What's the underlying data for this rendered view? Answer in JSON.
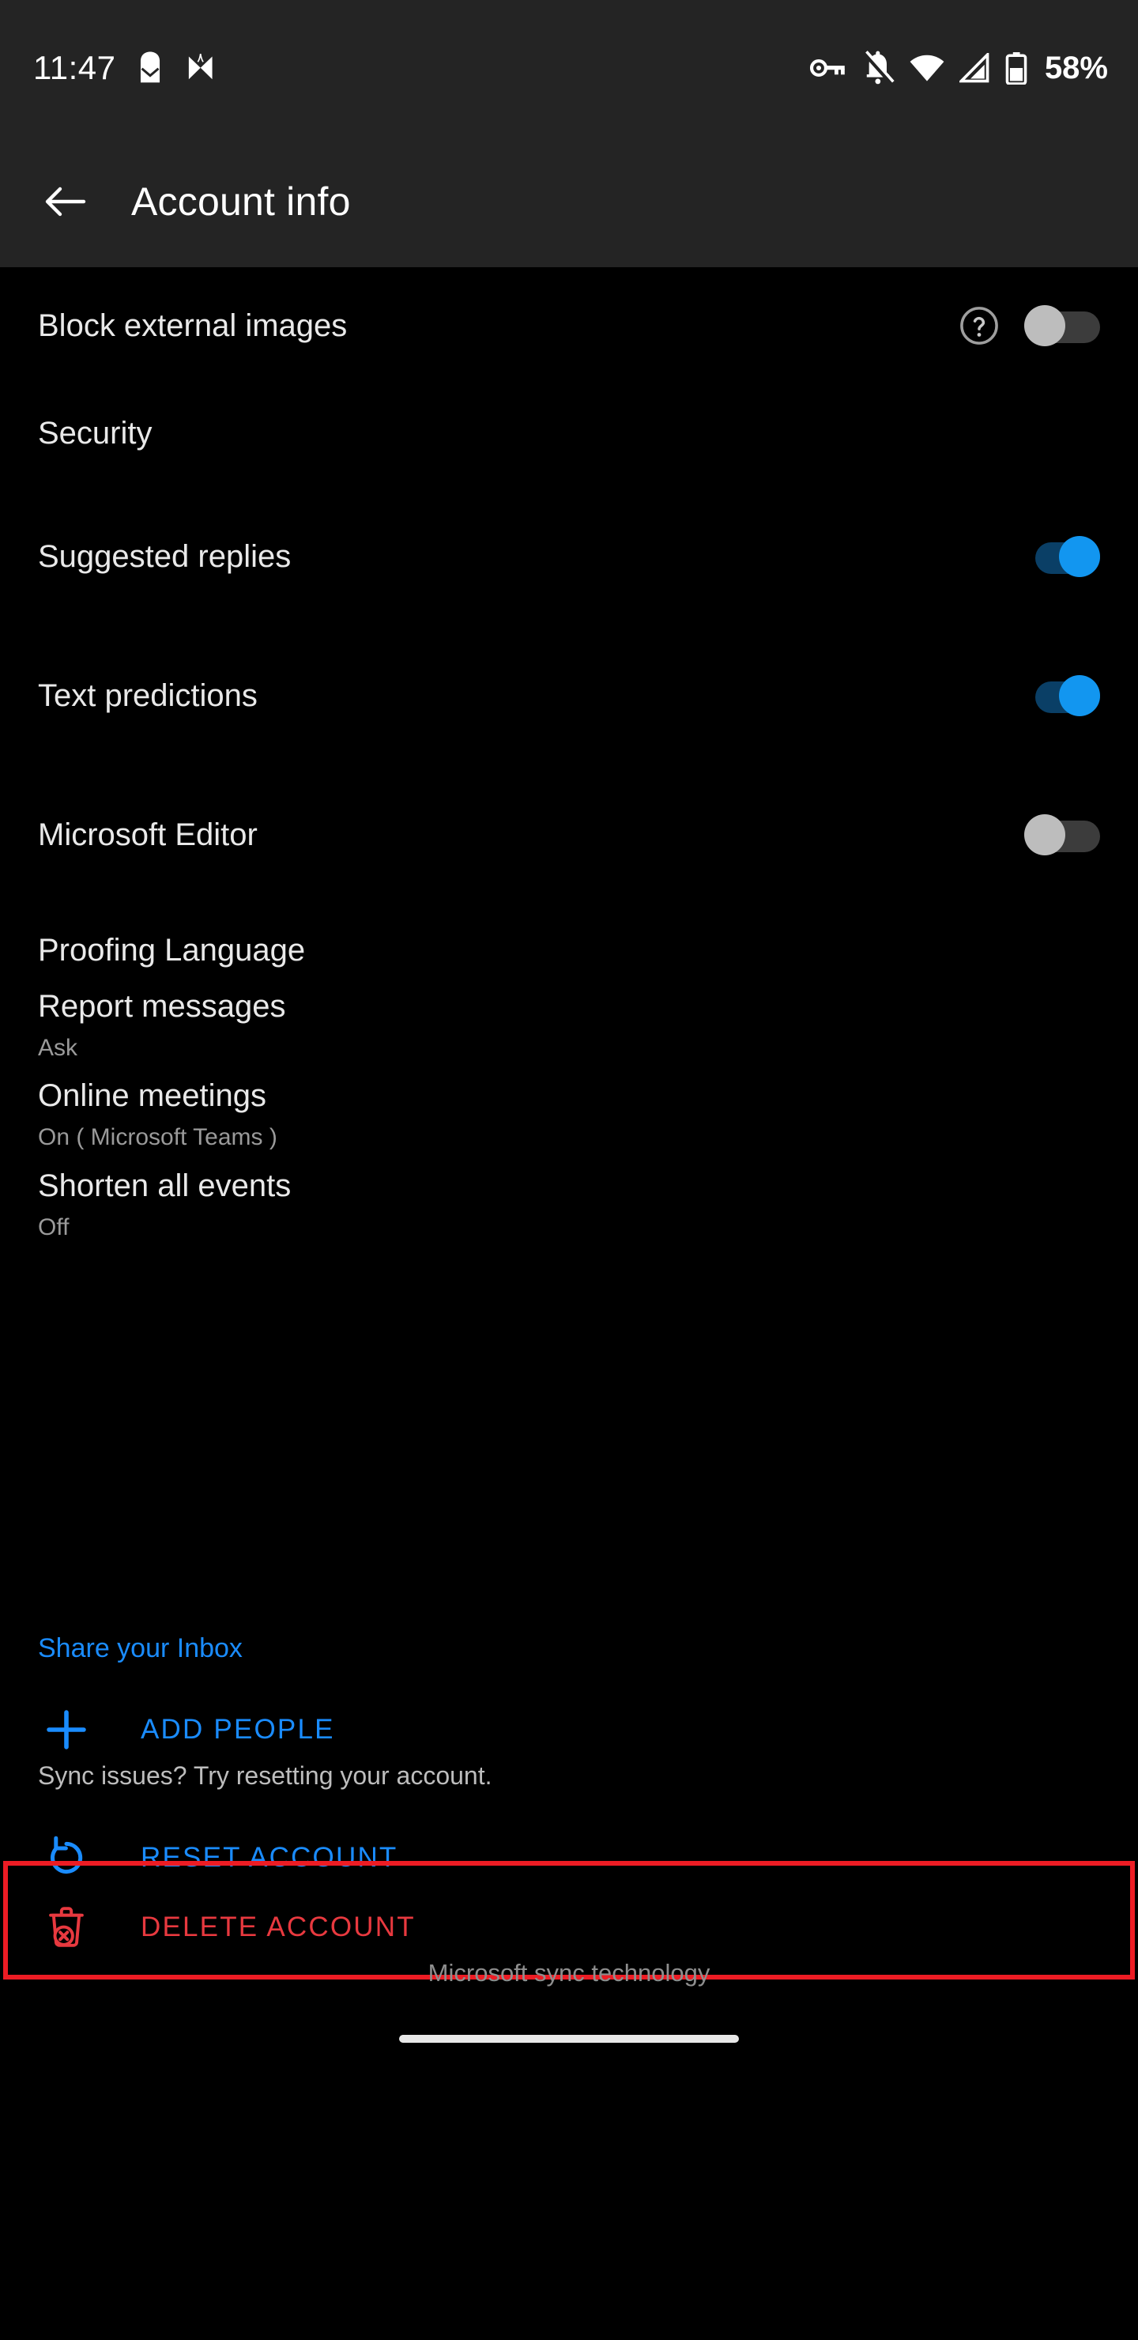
{
  "status_bar": {
    "time": "11:47",
    "battery_percent": "58%",
    "left_icons": [
      "mail-notification-icon",
      "outlook-butterfly-icon"
    ],
    "right_icons": [
      "vpn-key-icon",
      "notifications-off-icon",
      "wifi-icon",
      "cellular-signal-icon",
      "battery-icon"
    ]
  },
  "app_bar": {
    "back_icon": "back-arrow-icon",
    "title": "Account info"
  },
  "settings": [
    {
      "title": "Block external images",
      "help": "?",
      "toggle": "off"
    },
    {
      "title": "Security"
    },
    {
      "title": "Suggested replies",
      "toggle": "on"
    },
    {
      "title": "Text predictions",
      "toggle": "on"
    },
    {
      "title": "Microsoft Editor",
      "toggle": "off"
    },
    {
      "title": "Proofing Language"
    },
    {
      "title": "Report messages",
      "subtitle": "Ask"
    },
    {
      "title": "Online meetings",
      "subtitle": "On ( Microsoft Teams )"
    },
    {
      "title": "Shorten all events",
      "subtitle": "Off"
    }
  ],
  "share_section": {
    "link_label": "Share your Inbox",
    "add_people_label": "ADD PEOPLE",
    "add_people_icon": "plus-icon"
  },
  "reset_section": {
    "hint": "Sync issues? Try resetting your account.",
    "reset_label": "RESET ACCOUNT",
    "reset_icon": "refresh-icon"
  },
  "delete_section": {
    "delete_label": "DELETE ACCOUNT",
    "delete_icon": "trash-delete-icon",
    "highlighted": true
  },
  "footer": {
    "note": "Microsoft sync technology"
  },
  "colors": {
    "accent_blue": "#1a8cff",
    "toggle_on": "#1296f0",
    "danger_red": "#e8393f",
    "highlight_red": "#ed1c24",
    "background": "#000000",
    "appbar_background": "#242424"
  }
}
